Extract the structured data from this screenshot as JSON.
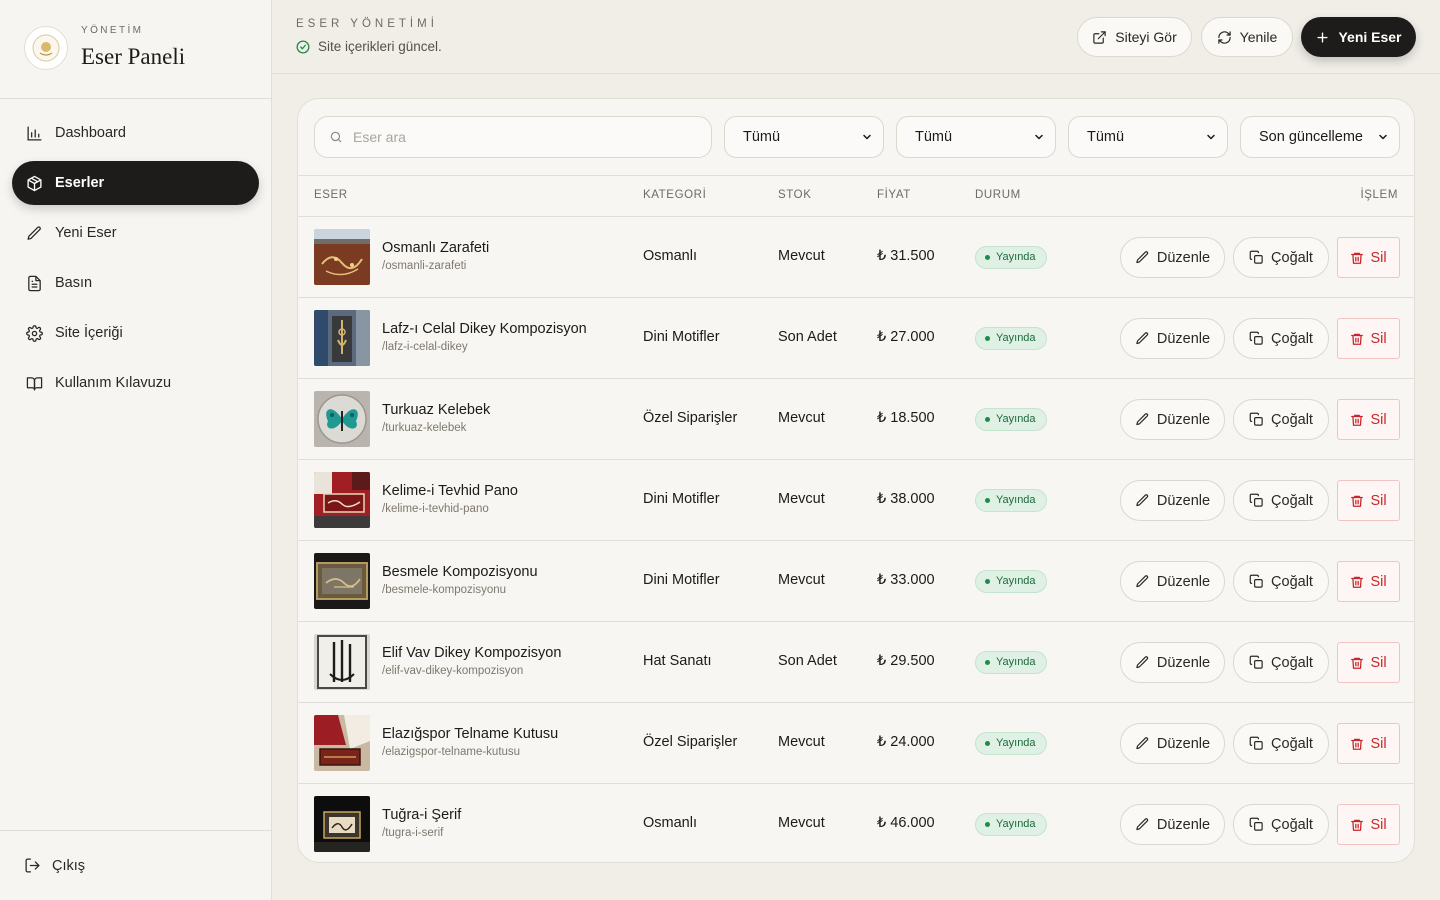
{
  "sidebar": {
    "kicker": "YÖNETİM",
    "title": "Eser Paneli",
    "items": [
      {
        "label": "Dashboard",
        "icon": "chart-icon",
        "active": false
      },
      {
        "label": "Eserler",
        "icon": "box-icon",
        "active": true
      },
      {
        "label": "Yeni Eser",
        "icon": "pencil-icon",
        "active": false
      },
      {
        "label": "Basın",
        "icon": "document-icon",
        "active": false
      },
      {
        "label": "Site İçeriği",
        "icon": "gear-icon",
        "active": false
      },
      {
        "label": "Kullanım Kılavuzu",
        "icon": "book-icon",
        "active": false
      }
    ],
    "logout": "Çıkış"
  },
  "header": {
    "kicker": "ESER YÖNETİMİ",
    "status": "Site içerikleri güncel.",
    "view_site": "Siteyi Gör",
    "refresh": "Yenile",
    "new": "Yeni Eser"
  },
  "filters": {
    "search_placeholder": "Eser ara",
    "select1": "Tümü",
    "select2": "Tümü",
    "select3": "Tümü",
    "sort": "Son güncelleme"
  },
  "table": {
    "columns": {
      "eser": "ESER",
      "kategori": "KATEGORİ",
      "stok": "STOK",
      "fiyat": "FİYAT",
      "durum": "DURUM",
      "islem": "İŞLEM"
    },
    "action_labels": {
      "edit": "Düzenle",
      "copy": "Çoğalt",
      "delete": "Sil"
    },
    "rows": [
      {
        "name": "Osmanlı Zarafeti",
        "slug": "/osmanli-zarafeti",
        "category": "Osmanlı",
        "stock": "Mevcut",
        "price": "₺ 31.500",
        "status": "Yayında"
      },
      {
        "name": "Lafz-ı Celal Dikey Kompozisyon",
        "slug": "/lafz-i-celal-dikey",
        "category": "Dini Motifler",
        "stock": "Son Adet",
        "price": "₺ 27.000",
        "status": "Yayında"
      },
      {
        "name": "Turkuaz Kelebek",
        "slug": "/turkuaz-kelebek",
        "category": "Özel Siparişler",
        "stock": "Mevcut",
        "price": "₺ 18.500",
        "status": "Yayında"
      },
      {
        "name": "Kelime-i Tevhid Pano",
        "slug": "/kelime-i-tevhid-pano",
        "category": "Dini Motifler",
        "stock": "Mevcut",
        "price": "₺ 38.000",
        "status": "Yayında"
      },
      {
        "name": "Besmele Kompozisyonu",
        "slug": "/besmele-kompozisyonu",
        "category": "Dini Motifler",
        "stock": "Mevcut",
        "price": "₺ 33.000",
        "status": "Yayında"
      },
      {
        "name": "Elif Vav Dikey Kompozisyon",
        "slug": "/elif-vav-dikey-kompozisyon",
        "category": "Hat Sanatı",
        "stock": "Son Adet",
        "price": "₺ 29.500",
        "status": "Yayında"
      },
      {
        "name": "Elazığspor Telname Kutusu",
        "slug": "/elazigspor-telname-kutusu",
        "category": "Özel Siparişler",
        "stock": "Mevcut",
        "price": "₺ 24.000",
        "status": "Yayında"
      },
      {
        "name": "Tuğra-i Şerif",
        "slug": "/tugra-i-serif",
        "category": "Osmanlı",
        "stock": "Mevcut",
        "price": "₺ 46.000",
        "status": "Yayında"
      }
    ]
  },
  "colors": {
    "accent": "#1d1c1a",
    "background": "#f1eee8",
    "success": "#1f8a4c",
    "danger": "#c8262b"
  }
}
